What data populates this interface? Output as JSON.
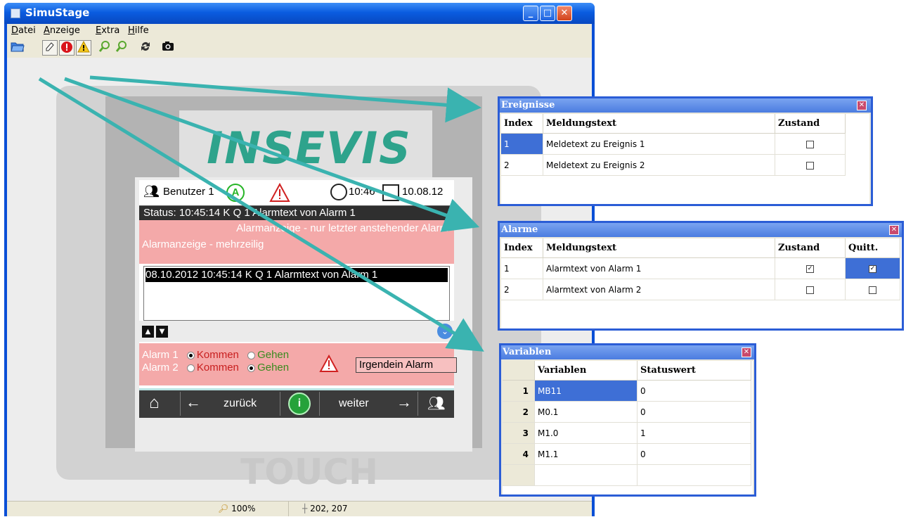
{
  "window": {
    "title": "SimuStage",
    "btn_min": "_",
    "btn_max": "□",
    "btn_close": "✕"
  },
  "menu": {
    "datei": {
      "u": "D",
      "rest": "atei"
    },
    "anzeige": {
      "u": "A",
      "rest": "nzeige"
    },
    "extra": {
      "u": "E",
      "rest": "xtra"
    },
    "hilfe": {
      "u": "H",
      "rest": "ilfe"
    }
  },
  "toolbar": {
    "icons": [
      "open-folder-icon",
      "eraser-icon",
      "alarm-icon",
      "warning-icon",
      "zoom-in-icon",
      "zoom-out-icon",
      "rotate-icon",
      "camera-icon"
    ]
  },
  "device": {
    "logo": "INSEVIS",
    "touch_label": "TOUCH"
  },
  "hmi": {
    "user": "Benutzer 1",
    "mode_badge": "A",
    "time": "10:46",
    "date": "10.08.12",
    "status_line": "Status:  10:45:14 K Q 1 Alarmtext von Alarm 1",
    "alarm_single": "Alarmanzeige - nur letzter anstehender Alarm",
    "alarm_multi": "Alarmanzeige - mehrzeilig",
    "list_row": "08.10.2012 10:45:14 K Q 1 Alarmtext von Alarm 1",
    "alarm1": "Alarm 1",
    "alarm2": "Alarm 2",
    "kommen": "Kommen",
    "gehen": "Gehen",
    "any_alarm": "Irgendein Alarm",
    "back": "zurück",
    "next": "weiter"
  },
  "statusbar": {
    "zoom": "100%",
    "coords": "202, 207"
  },
  "ereignisse": {
    "title": "Ereignisse",
    "headers": [
      "Index",
      "Meldungstext",
      "Zustand"
    ],
    "rows": [
      {
        "index": "1",
        "text": "Meldetext zu Ereignis 1",
        "state": false
      },
      {
        "index": "2",
        "text": "Meldetext zu Ereignis 2",
        "state": false
      }
    ]
  },
  "alarme": {
    "title": "Alarme",
    "headers": [
      "Index",
      "Meldungstext",
      "Zustand",
      "Quitt."
    ],
    "rows": [
      {
        "index": "1",
        "text": "Alarmtext von Alarm 1",
        "state": true,
        "quitt": true
      },
      {
        "index": "2",
        "text": "Alarmtext von Alarm 2",
        "state": false,
        "quitt": false
      }
    ]
  },
  "variablen": {
    "title": "Variablen",
    "headers": [
      "Variablen",
      "Statuswert"
    ],
    "rows": [
      {
        "num": "1",
        "name": "MB11",
        "value": "0"
      },
      {
        "num": "2",
        "name": "M0.1",
        "value": "0"
      },
      {
        "num": "3",
        "name": "M1.0",
        "value": "1"
      },
      {
        "num": "4",
        "name": "M1.1",
        "value": "0"
      }
    ]
  },
  "colors": {
    "arrow": "#3ab3b0",
    "titlebar": "#0a5ce0",
    "alarm_bg": "#f4a9a9",
    "logo": "#2ea38c"
  }
}
